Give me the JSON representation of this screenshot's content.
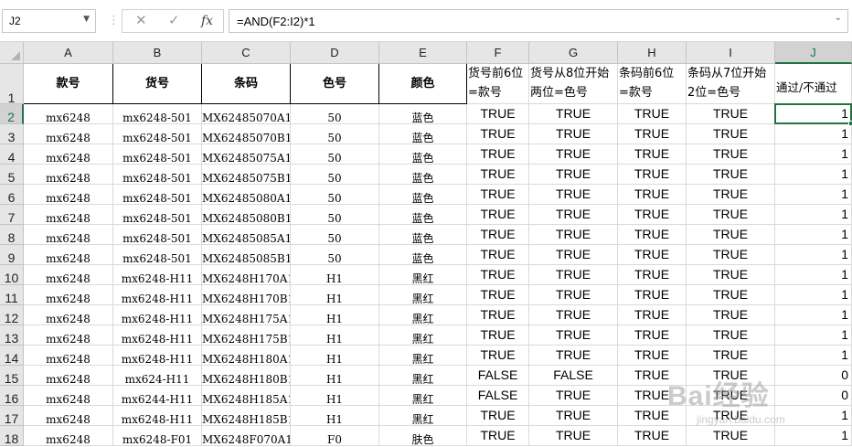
{
  "formula_bar": {
    "name_box": "J2",
    "cancel_icon": "✕",
    "enter_icon": "✓",
    "fx_label": "fx",
    "formula": "=AND(F2:I2)*1"
  },
  "columns": [
    "A",
    "B",
    "C",
    "D",
    "E",
    "F",
    "G",
    "H",
    "I",
    "J"
  ],
  "selected_column": "J",
  "selected_row": "2",
  "header_row": {
    "row_label": "1",
    "A": "款号",
    "B": "货号",
    "C": "条码",
    "D": "色号",
    "E": "颜色",
    "F_line1": "货号前6位",
    "F_line2": "=款号",
    "G_line1": "货号从8位开始",
    "G_line2": "两位=色号",
    "H_line1": "条码前6位",
    "H_line2": "=款号",
    "I_line1": "条码从7位开始",
    "I_line2": "2位=色号",
    "J": "通过/不通过"
  },
  "rows": [
    {
      "r": "2",
      "a": "mx6248",
      "b": "mx6248-501",
      "c": "MX62485070A1",
      "d": "50",
      "e": "蓝色",
      "f": "TRUE",
      "g": "TRUE",
      "h": "TRUE",
      "i": "TRUE",
      "j": "1"
    },
    {
      "r": "3",
      "a": "mx6248",
      "b": "mx6248-501",
      "c": "MX62485070B1",
      "d": "50",
      "e": "蓝色",
      "f": "TRUE",
      "g": "TRUE",
      "h": "TRUE",
      "i": "TRUE",
      "j": "1"
    },
    {
      "r": "4",
      "a": "mx6248",
      "b": "mx6248-501",
      "c": "MX62485075A1",
      "d": "50",
      "e": "蓝色",
      "f": "TRUE",
      "g": "TRUE",
      "h": "TRUE",
      "i": "TRUE",
      "j": "1"
    },
    {
      "r": "5",
      "a": "mx6248",
      "b": "mx6248-501",
      "c": "MX62485075B1",
      "d": "50",
      "e": "蓝色",
      "f": "TRUE",
      "g": "TRUE",
      "h": "TRUE",
      "i": "TRUE",
      "j": "1"
    },
    {
      "r": "6",
      "a": "mx6248",
      "b": "mx6248-501",
      "c": "MX62485080A1",
      "d": "50",
      "e": "蓝色",
      "f": "TRUE",
      "g": "TRUE",
      "h": "TRUE",
      "i": "TRUE",
      "j": "1"
    },
    {
      "r": "7",
      "a": "mx6248",
      "b": "mx6248-501",
      "c": "MX62485080B1",
      "d": "50",
      "e": "蓝色",
      "f": "TRUE",
      "g": "TRUE",
      "h": "TRUE",
      "i": "TRUE",
      "j": "1"
    },
    {
      "r": "8",
      "a": "mx6248",
      "b": "mx6248-501",
      "c": "MX62485085A1",
      "d": "50",
      "e": "蓝色",
      "f": "TRUE",
      "g": "TRUE",
      "h": "TRUE",
      "i": "TRUE",
      "j": "1"
    },
    {
      "r": "9",
      "a": "mx6248",
      "b": "mx6248-501",
      "c": "MX62485085B1",
      "d": "50",
      "e": "蓝色",
      "f": "TRUE",
      "g": "TRUE",
      "h": "TRUE",
      "i": "TRUE",
      "j": "1"
    },
    {
      "r": "10",
      "a": "mx6248",
      "b": "mx6248-H11",
      "c": "MX6248H170A1",
      "d": "H1",
      "e": "黑红",
      "f": "TRUE",
      "g": "TRUE",
      "h": "TRUE",
      "i": "TRUE",
      "j": "1"
    },
    {
      "r": "11",
      "a": "mx6248",
      "b": "mx6248-H11",
      "c": "MX6248H170B1",
      "d": "H1",
      "e": "黑红",
      "f": "TRUE",
      "g": "TRUE",
      "h": "TRUE",
      "i": "TRUE",
      "j": "1"
    },
    {
      "r": "12",
      "a": "mx6248",
      "b": "mx6248-H11",
      "c": "MX6248H175A1",
      "d": "H1",
      "e": "黑红",
      "f": "TRUE",
      "g": "TRUE",
      "h": "TRUE",
      "i": "TRUE",
      "j": "1"
    },
    {
      "r": "13",
      "a": "mx6248",
      "b": "mx6248-H11",
      "c": "MX6248H175B1",
      "d": "H1",
      "e": "黑红",
      "f": "TRUE",
      "g": "TRUE",
      "h": "TRUE",
      "i": "TRUE",
      "j": "1"
    },
    {
      "r": "14",
      "a": "mx6248",
      "b": "mx6248-H11",
      "c": "MX6248H180A1",
      "d": "H1",
      "e": "黑红",
      "f": "TRUE",
      "g": "TRUE",
      "h": "TRUE",
      "i": "TRUE",
      "j": "1"
    },
    {
      "r": "15",
      "a": "mx6248",
      "b": "mx624-H11",
      "c": "MX6248H180B1",
      "d": "H1",
      "e": "黑红",
      "f": "FALSE",
      "g": "FALSE",
      "h": "TRUE",
      "i": "TRUE",
      "j": "0"
    },
    {
      "r": "16",
      "a": "mx6248",
      "b": "mx6244-H11",
      "c": "MX6248H185A1",
      "d": "H1",
      "e": "黑红",
      "f": "FALSE",
      "g": "TRUE",
      "h": "TRUE",
      "i": "TRUE",
      "j": "0"
    },
    {
      "r": "17",
      "a": "mx6248",
      "b": "mx6248-H11",
      "c": "MX6248H185B1",
      "d": "H1",
      "e": "黑红",
      "f": "TRUE",
      "g": "TRUE",
      "h": "TRUE",
      "i": "TRUE",
      "j": "1"
    },
    {
      "r": "18",
      "a": "mx6248",
      "b": "mx6248-F01",
      "c": "MX6248F070A1",
      "d": "F0",
      "e": "肤色",
      "f": "TRUE",
      "g": "TRUE",
      "h": "TRUE",
      "i": "TRUE",
      "j": "1"
    }
  ],
  "watermark": {
    "main": "Bai经验",
    "sub": "jingyan.baidu.com"
  },
  "colors": {
    "accent": "#217346",
    "header_bg": "#e6e6e6",
    "gridline": "#dadada"
  }
}
